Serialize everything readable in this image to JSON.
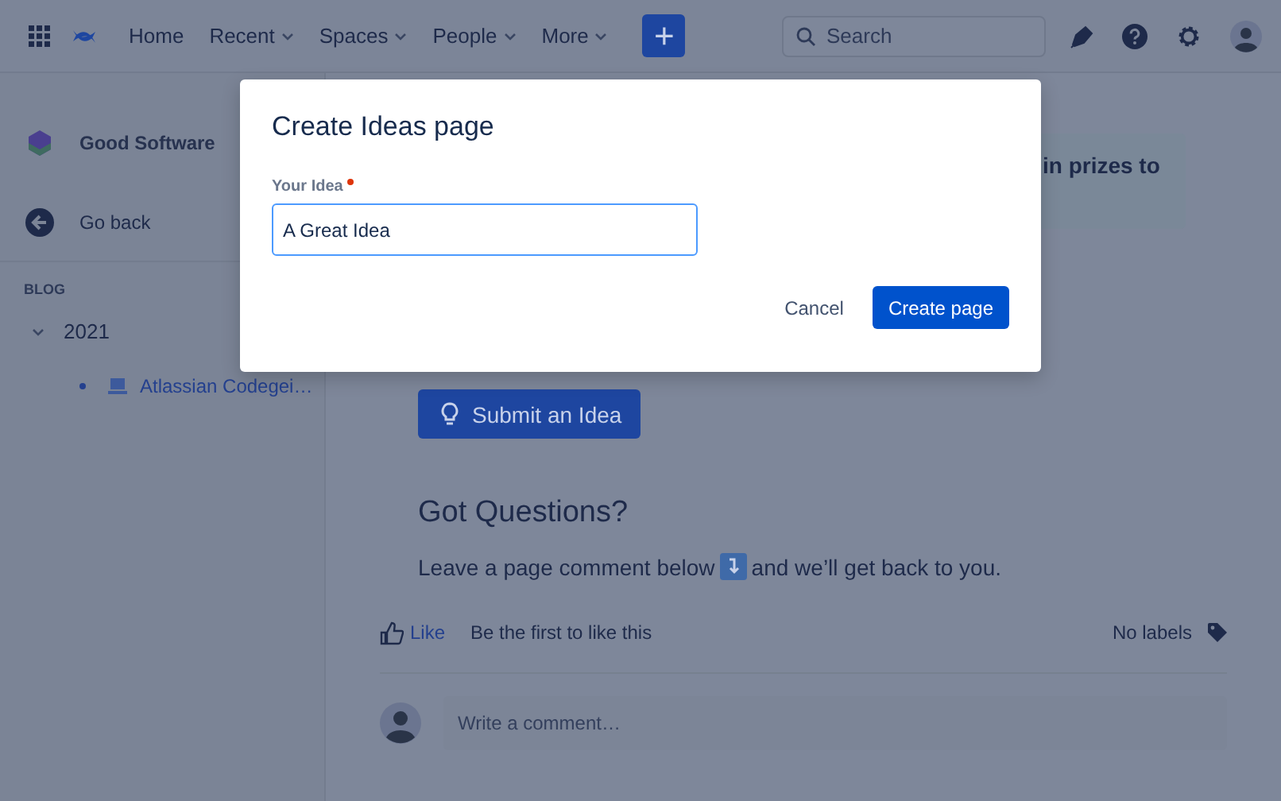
{
  "header": {
    "nav": [
      {
        "label": "Home",
        "dropdown": false
      },
      {
        "label": "Recent",
        "dropdown": true
      },
      {
        "label": "Spaces",
        "dropdown": true
      },
      {
        "label": "People",
        "dropdown": true
      },
      {
        "label": "More",
        "dropdown": true
      }
    ],
    "create_button": "+",
    "search": {
      "placeholder": "Search"
    }
  },
  "sidebar": {
    "space_name": "Good Software",
    "back_link": "Go back",
    "section": "BLOG",
    "tree": [
      {
        "label": "2021",
        "expanded": true,
        "children": [
          {
            "label": "Atlassian Codegei…"
          }
        ]
      }
    ]
  },
  "content": {
    "callout_text": "in prizes to",
    "submit_button": "Submit an Idea",
    "heading": "Got Questions?",
    "paragraph_before": "Leave a page comment below",
    "paragraph_after": "and we’ll get back to you.",
    "like_link": "Like",
    "like_text": "Be the first to like this",
    "labels_text": "No labels",
    "comment": {
      "placeholder": "Write a comment…"
    }
  },
  "dialog": {
    "title": "Create Ideas page",
    "field_label": "Your Idea",
    "required": true,
    "field_value": "A Great Idea",
    "buttons": [
      {
        "label": "Cancel",
        "kind": "subtle"
      },
      {
        "label": "Create page",
        "kind": "primary"
      }
    ]
  }
}
